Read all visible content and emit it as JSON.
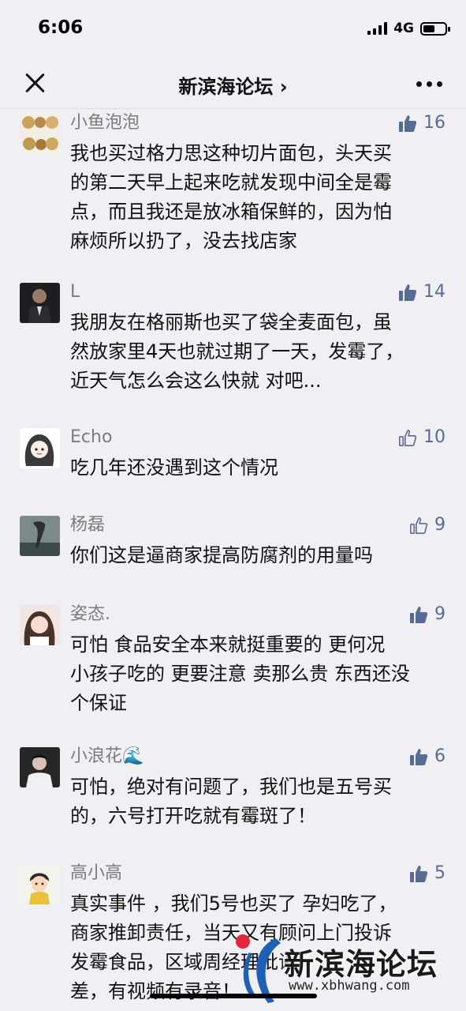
{
  "status_bar": {
    "time": "6:06",
    "network": "4G"
  },
  "nav": {
    "title": "新滨海论坛 ›"
  },
  "comments": [
    {
      "user": "小鱼泡泡",
      "likes": "16",
      "liked": true,
      "lines": [
        "我也买过格力思这种切片面包，头天买",
        "的第二天早上起来吃就发现中间全是霉",
        "点，而且我还是放冰箱保鲜的，因为怕",
        "麻烦所以扔了，没去找店家"
      ]
    },
    {
      "user": "L",
      "likes": "14",
      "liked": true,
      "lines": [
        "我朋友在格丽斯也买了袋全麦面包，虽",
        "然放家里4天也就过期了一天，发霉了，",
        "近天气怎么会这么快就 对吧..."
      ]
    },
    {
      "user": "Echo",
      "likes": "10",
      "liked": false,
      "lines": [
        "吃几年还没遇到这个情况"
      ]
    },
    {
      "user": "杨磊",
      "likes": "9",
      "liked": false,
      "lines": [
        "你们这是逼商家提高防腐剂的用量吗"
      ]
    },
    {
      "user": "姿态.",
      "likes": "9",
      "liked": true,
      "lines": [
        "可怕  食品安全本来就挺重要的  更何况",
        "小孩子吃的 更要注意 卖那么贵 东西还没",
        "个保证"
      ]
    },
    {
      "user": "小浪花🌊",
      "likes": "6",
      "liked": true,
      "lines": [
        "可怕，绝对有问题了，我们也是五号买",
        "的，六号打开吃就有霉斑了！"
      ]
    },
    {
      "user": "高小高",
      "likes": "5",
      "liked": true,
      "lines": [
        "真实事件 ，我们5号也买了 孕妇吃了，",
        "商家推卸责任，当天又有顾问上门投诉",
        "发霉食品，区域周经理批评",
        "差，有视频有录音！"
      ]
    }
  ],
  "watermark": {
    "name": "新滨海论坛",
    "url": "www.xbhwang.com"
  },
  "colors": {
    "like_blue": "#576b95",
    "background": "#efeff4"
  }
}
